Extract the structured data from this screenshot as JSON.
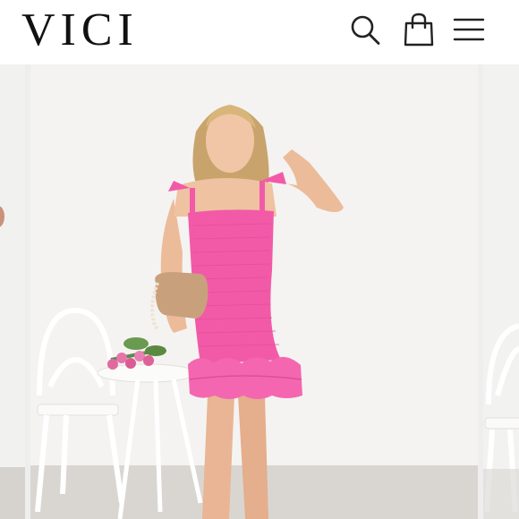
{
  "header": {
    "logo_text": "VICI",
    "icons": [
      "search-icon",
      "shopping-bag-icon",
      "menu-icon"
    ]
  },
  "gallery": {
    "current_image": "model-in-pink-smocked-ruffle-mini-dress",
    "previous_image": "partial-previous-product-photo",
    "next_image": "partial-next-product-photo"
  },
  "colors": {
    "logo": "#111111",
    "icons": "#222222",
    "dress_pink": "#f25aa8",
    "background": "#ffffff"
  }
}
